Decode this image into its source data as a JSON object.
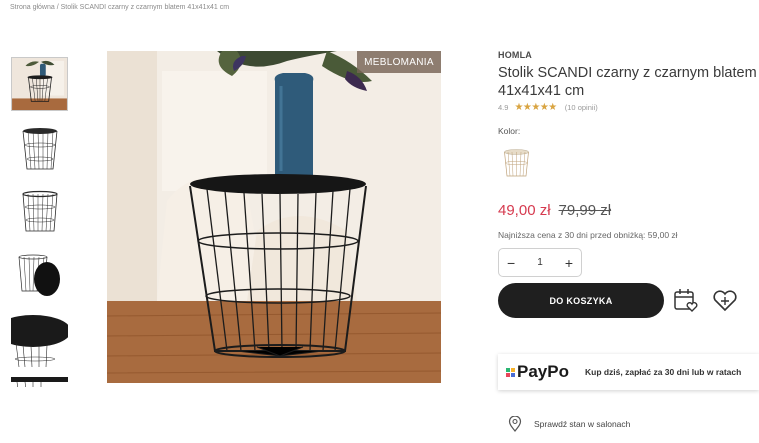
{
  "breadcrumb": "Strona główna / Stolik SCANDI czarny z czarnym blatem 41x41x41 cm",
  "gallery": {
    "badge": "MEBLOMANIA",
    "thumbnails": [
      "photo-thumbnail",
      "table-thumbnail",
      "table-thumbnail",
      "table-lid-thumbnail",
      "table-top-thumbnail",
      "table-edge-thumbnail"
    ]
  },
  "product": {
    "brand": "HOMLA",
    "title": "Stolik SCANDI czarny z czarnym blatem 41x41x41 cm",
    "rating_score": "4.9",
    "stars": "★★★★★",
    "reviews": "(10 opinii)",
    "color_label": "Kolor:",
    "price": "49,00 zł",
    "old_price": "79,99 zł",
    "lowest_price_note": "Najniższa cena z 30 dni przed obniżką: 59,00 zł",
    "quantity": "1",
    "minus": "−",
    "plus": "+",
    "add_to_cart": "DO KOSZYKA"
  },
  "paypo": {
    "logo": "PayPo",
    "text": "Kup dziś, zapłać za 30 dni lub w ratach"
  },
  "store_check": "Sprawdź stan w salonach",
  "colors": {
    "accent_price": "#d63a4f",
    "button_bg": "#1f1f1f",
    "stars": "#d9a441",
    "paypo_dots": [
      "#2bb673",
      "#f7b32b",
      "#e8465a",
      "#4a6cd4"
    ]
  },
  "icons": [
    "calendar-heart-icon",
    "heart-plus-icon",
    "location-pin-icon"
  ]
}
